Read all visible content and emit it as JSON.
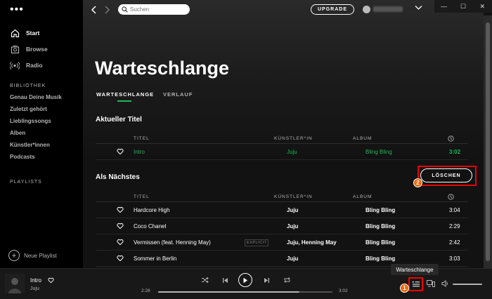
{
  "sidebar": {
    "menu_icon": "more-dots-icon",
    "nav": [
      {
        "label": "Start",
        "icon": "home-icon"
      },
      {
        "label": "Browse",
        "icon": "browse-icon"
      },
      {
        "label": "Radio",
        "icon": "radio-icon"
      }
    ],
    "library_label": "BIBLIOTHEK",
    "library": [
      "Genau Deine Musik",
      "Zuletzt gehört",
      "Lieblingssongs",
      "Alben",
      "Künstler*innen",
      "Podcasts"
    ],
    "playlists_label": "PLAYLISTS",
    "new_playlist": "Neue Playlist"
  },
  "topbar": {
    "search_placeholder": "Suchen",
    "upgrade_label": "UPGRADE"
  },
  "page": {
    "title": "Warteschlange",
    "tabs": [
      {
        "label": "WARTESCHLANGE",
        "active": true
      },
      {
        "label": "VERLAUF",
        "active": false
      }
    ]
  },
  "current": {
    "heading": "Aktueller Titel",
    "columns": {
      "title": "TITEL",
      "artist": "KÜNSTLER*IN",
      "album": "ALBUM"
    },
    "track": {
      "title": "Intro",
      "artist": "Juju",
      "album": "Bling Bling",
      "duration": "3:02"
    }
  },
  "next": {
    "heading": "Als Nächstes",
    "clear_label": "LÖSCHEN",
    "columns": {
      "title": "TITEL",
      "artist": "KÜNSTLER*IN",
      "album": "ALBUM"
    },
    "tracks": [
      {
        "title": "Hardcore High",
        "artist": "Juju",
        "album": "Bling Bling",
        "duration": "3:04",
        "explicit": ""
      },
      {
        "title": "Coco Chanel",
        "artist": "Juju",
        "album": "Bling Bling",
        "duration": "2:29",
        "explicit": ""
      },
      {
        "title": "Vermissen (feat. Henning May)",
        "artist": "Juju, Henning May",
        "album": "Bling Bling",
        "duration": "2:42",
        "explicit": "EXPLICIT"
      },
      {
        "title": "Sommer in Berlin",
        "artist": "Juju",
        "album": "Bling Bling",
        "duration": "3:03",
        "explicit": ""
      }
    ]
  },
  "player": {
    "title": "Intro",
    "artist": "Juju",
    "elapsed": "2:28",
    "total": "3:02",
    "progress": 0.81,
    "queue_tooltip": "Warteschlange"
  },
  "markers": {
    "one": "1",
    "two": "2"
  },
  "colors": {
    "accent": "#1db954",
    "highlight": "#e00000",
    "marker": "#e86a0a"
  }
}
